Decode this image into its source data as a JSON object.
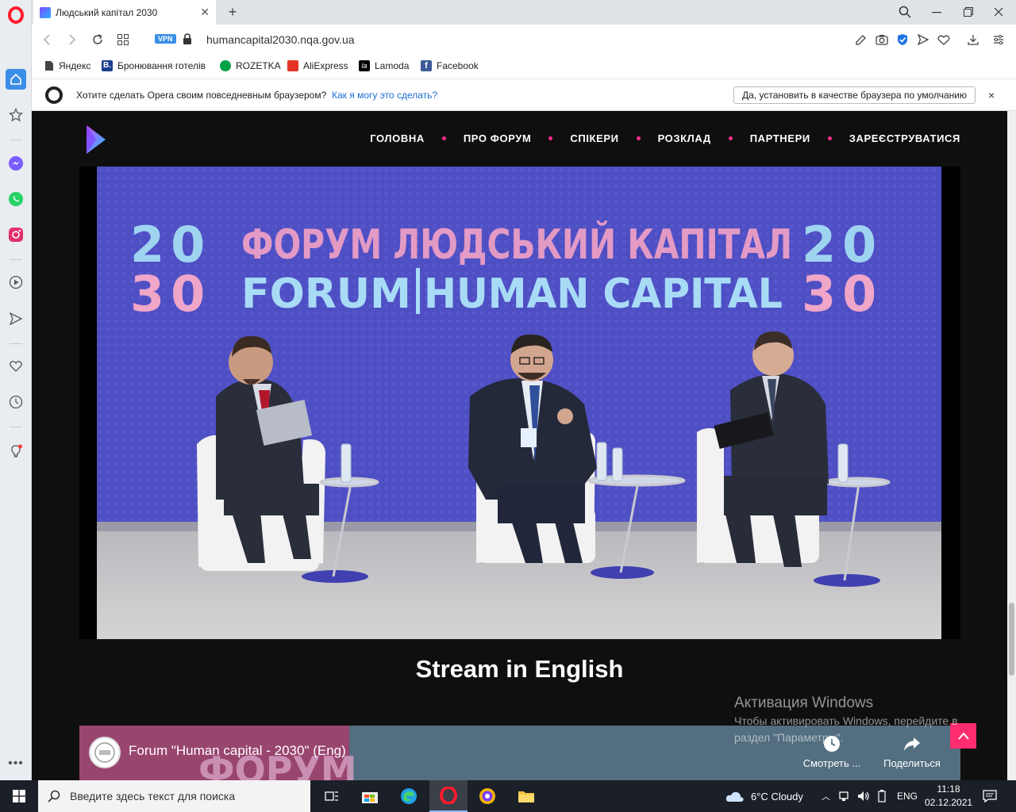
{
  "tab": {
    "title": "Людський капітал 2030"
  },
  "address": {
    "vpn": "VPN",
    "url": "humancapital2030.nqa.gov.ua"
  },
  "bookmarks": [
    {
      "label": "Яндекс"
    },
    {
      "label": "Бронювання готелів"
    },
    {
      "label": "ROZETKA"
    },
    {
      "label": "AliExpress"
    },
    {
      "label": "Lamoda"
    },
    {
      "label": "Facebook"
    }
  ],
  "prompt": {
    "text": "Хотите сделать Opera своим повседневным браузером?",
    "link": "Как я могу это сделать?",
    "button": "Да, установить в качестве браузера по умолчанию",
    "close": "×"
  },
  "site": {
    "menu": [
      "ГОЛОВНА",
      "ПРО ФОРУМ",
      "СПІКЕРИ",
      "РОЗКЛАД",
      "ПАРТНЕРИ",
      "ЗАРЕЄСТРУВАТИСЯ"
    ],
    "banner": {
      "row1": "ФОРУМ ЛЮДСЬКИЙ КАПІТАЛ",
      "row2a": "FORUM",
      "row2b": "HUMAN CAPITAL",
      "digits_top": "20",
      "digits_bottom": "30"
    },
    "stream_title": "Stream in English",
    "youtube": {
      "title": "Forum \"Human capital - 2030\" (Eng)",
      "watch_later": "Смотреть ...",
      "share": "Поделиться",
      "bg_text": "ФОРУМ"
    }
  },
  "watermark": {
    "title": "Активация Windows",
    "line1": "Чтобы активировать Windows, перейдите в",
    "line2": "раздел \"Параметры\"."
  },
  "taskbar": {
    "search_placeholder": "Введите здесь текст для поиска",
    "weather": "6°C  Cloudy",
    "lang": "ENG",
    "time": "11:18",
    "date": "02.12.2021"
  }
}
